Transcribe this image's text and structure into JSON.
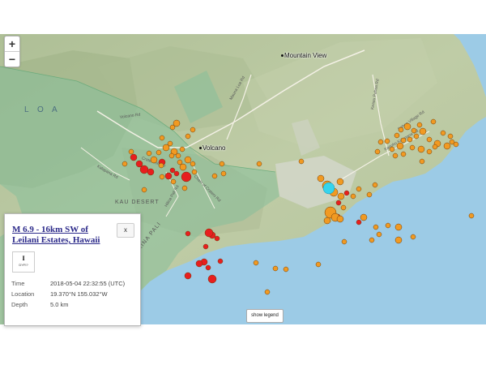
{
  "zoom": {
    "in_label": "+",
    "out_label": "−"
  },
  "places": [
    {
      "name": "Mountain View"
    },
    {
      "name": "Volcano"
    }
  ],
  "areas": {
    "kau_desert": "KAU DESERT",
    "kina_pali": "KINA PALI"
  },
  "sea": {
    "label": "L O A"
  },
  "roads": [
    {
      "name": "Volcano Rd"
    },
    {
      "name": "Mauna Loa Rd"
    },
    {
      "name": "Crater Rim Dr"
    },
    {
      "name": "Chain of Craters Rd"
    },
    {
      "name": "Keaau Pahoa Rd"
    },
    {
      "name": "Kalapana Rd"
    },
    {
      "name": "Hilina Pali Rd"
    },
    {
      "name": "Kapoho Kalapana Rd"
    },
    {
      "name": "Pahoa Village Rd"
    }
  ],
  "popup": {
    "title": "M 6.9 - 16km SW of Leilani Estates, Hawaii",
    "close_label": "x",
    "dyfi_intensity": "I",
    "dyfi_label": "DYFI?",
    "time_label": "Time",
    "time_value": "2018-05-04 22:32:55 (UTC)",
    "location_label": "Location",
    "location_value": "19.370°N 155.032°W",
    "depth_label": "Depth",
    "depth_value": "5.0 km"
  },
  "legend_button": "show legend",
  "colors": {
    "ocean": "#9ccbe6",
    "land": "#b9c9a2",
    "park": "#8cc29e",
    "quake_recent": "#e81e1e",
    "quake_old": "#f19a22",
    "quake_selected": "#35d4ee"
  }
}
